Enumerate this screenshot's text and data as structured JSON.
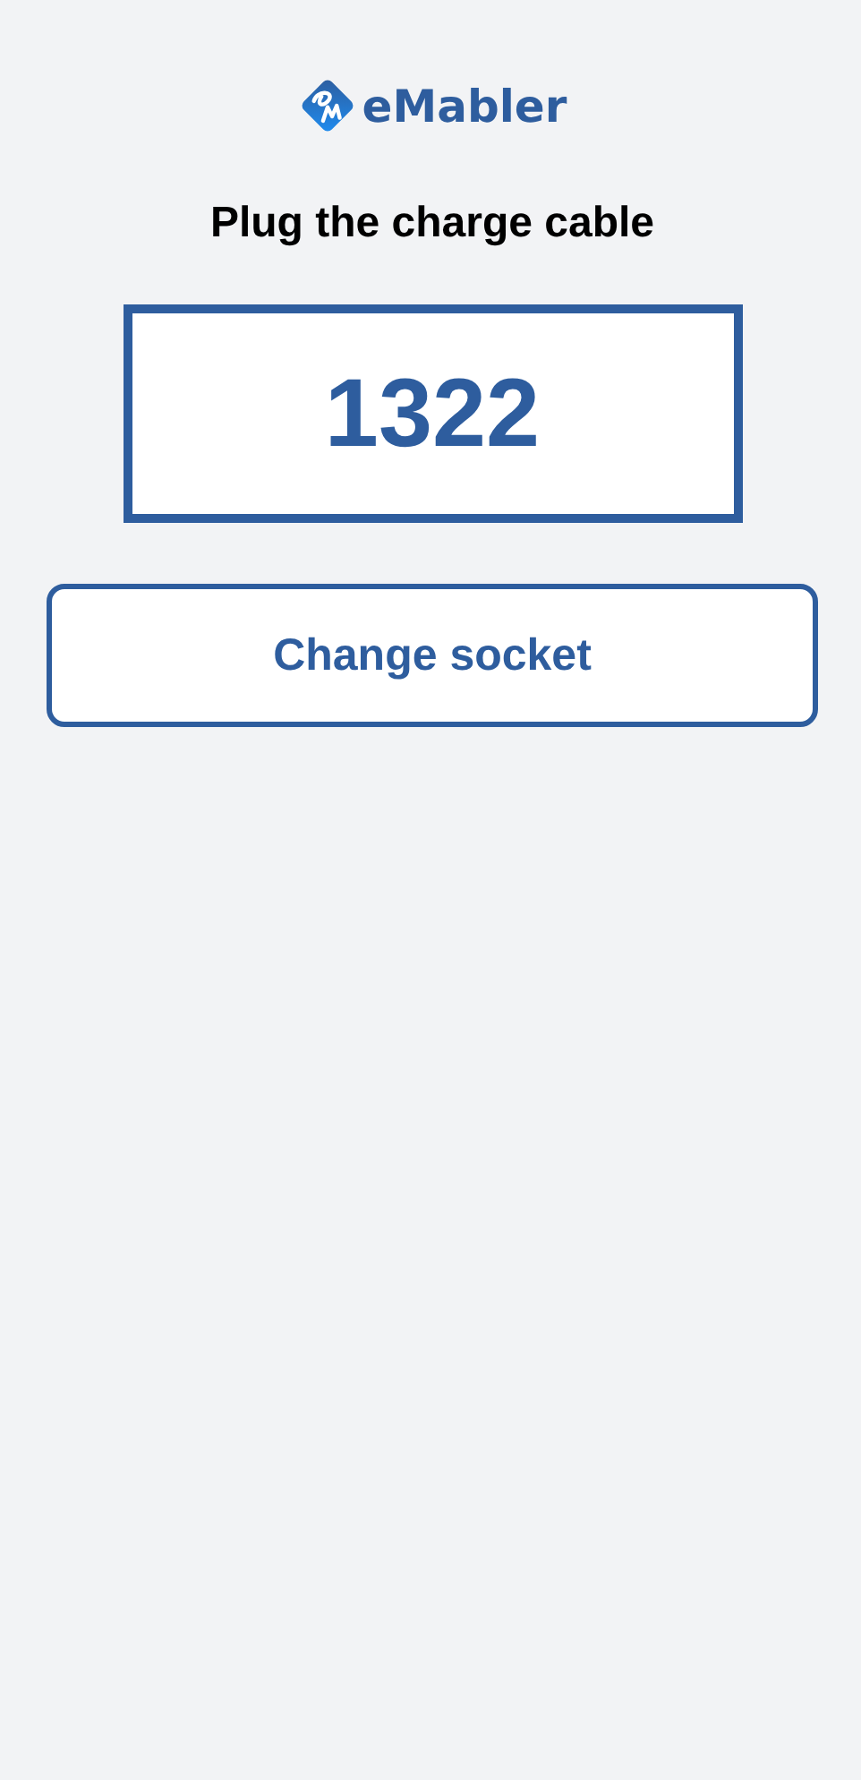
{
  "logo": {
    "text": "eMabler"
  },
  "title": "Plug the charge cable",
  "code": "1322",
  "button": "Change socket"
}
